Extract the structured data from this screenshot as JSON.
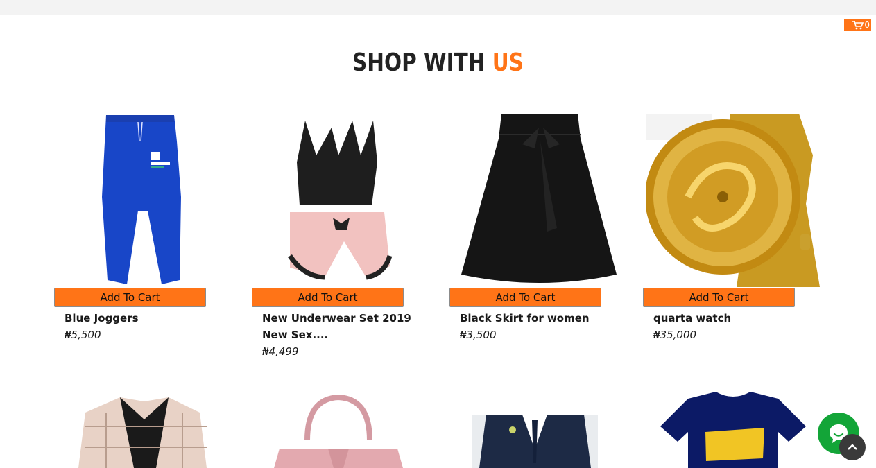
{
  "header": {
    "cart_count": "0"
  },
  "heading": {
    "part1": "SHOP WITH ",
    "part2": "US"
  },
  "colors": {
    "accent": "#ff7417",
    "chat": "#13a538"
  },
  "products": [
    {
      "title": "Blue Joggers",
      "price": "₦5,500",
      "button": "Add To Cart"
    },
    {
      "title": "New Underwear Set 2019 New Sex....",
      "price": "₦4,499",
      "button": "Add To Cart"
    },
    {
      "title": "Black Skirt for women",
      "price": "₦3,500",
      "button": "Add To Cart"
    },
    {
      "title": "quarta watch",
      "price": "₦35,000",
      "button": "Add To Cart"
    }
  ]
}
